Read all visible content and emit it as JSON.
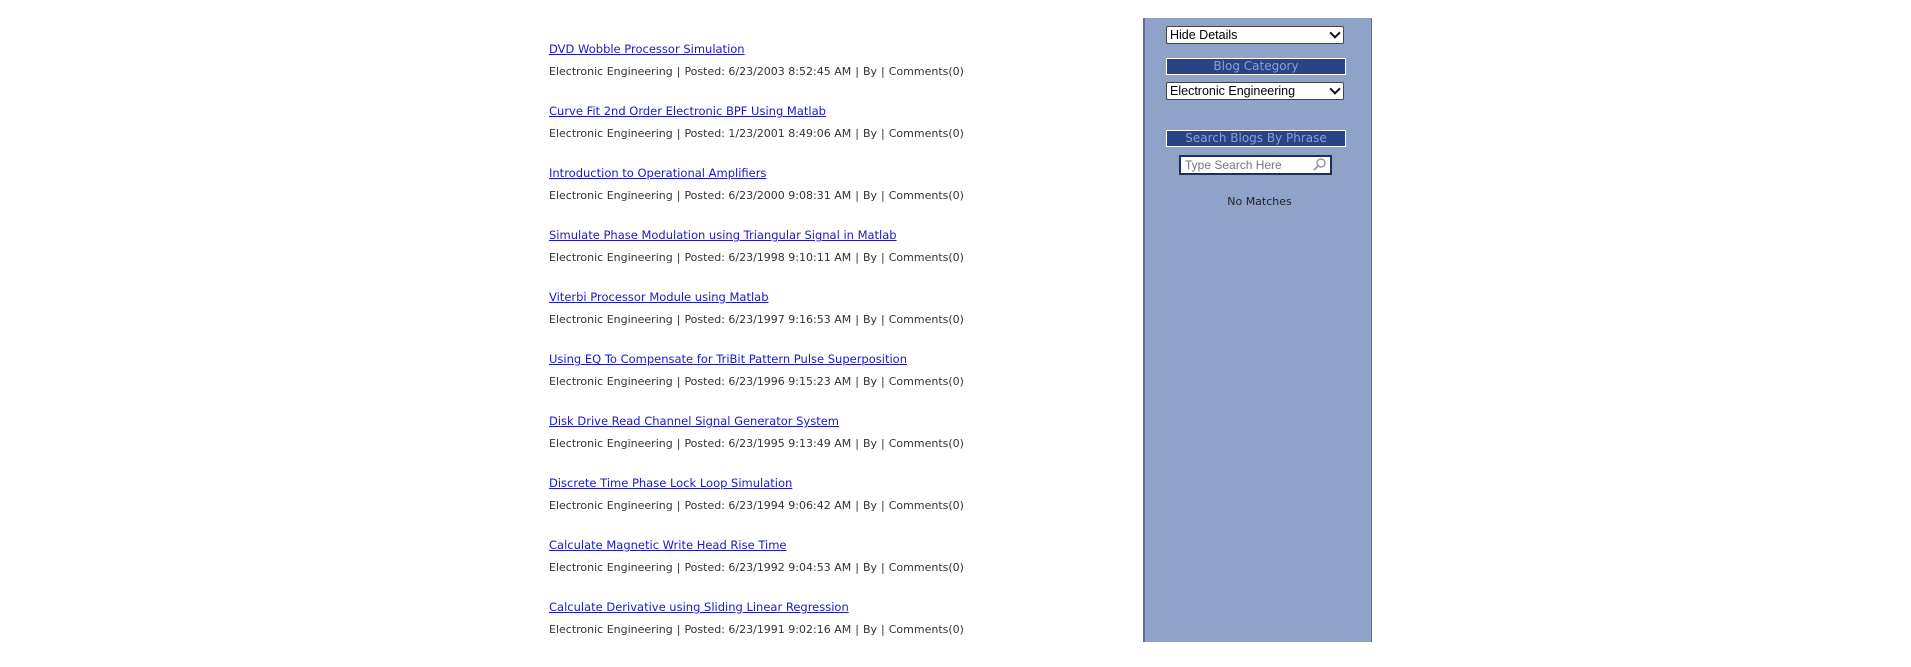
{
  "posts": [
    {
      "title": "DVD Wobble Processor Simulation",
      "category": "Electronic Engineering",
      "posted": "Posted: 6/23/2003 8:52:45 AM",
      "by": "By",
      "comments": "Comments(0)"
    },
    {
      "title": "Curve Fit 2nd Order Electronic BPF Using Matlab",
      "category": "Electronic Engineering",
      "posted": "Posted: 1/23/2001 8:49:06 AM",
      "by": "By",
      "comments": "Comments(0)"
    },
    {
      "title": "Introduction to Operational Amplifiers",
      "category": "Electronic Engineering",
      "posted": "Posted: 6/23/2000 9:08:31 AM",
      "by": "By",
      "comments": "Comments(0)"
    },
    {
      "title": "Simulate Phase Modulation using Triangular Signal in Matlab",
      "category": "Electronic Engineering",
      "posted": "Posted: 6/23/1998 9:10:11 AM",
      "by": "By",
      "comments": "Comments(0)"
    },
    {
      "title": "Viterbi Processor Module using Matlab",
      "category": "Electronic Engineering",
      "posted": "Posted: 6/23/1997 9:16:53 AM",
      "by": "By",
      "comments": "Comments(0)"
    },
    {
      "title": "Using EQ To Compensate for TriBit Pattern Pulse Superposition",
      "category": "Electronic Engineering",
      "posted": "Posted: 6/23/1996 9:15:23 AM",
      "by": "By",
      "comments": "Comments(0)"
    },
    {
      "title": "Disk Drive Read Channel Signal Generator System",
      "category": "Electronic Engineering",
      "posted": "Posted: 6/23/1995 9:13:49 AM",
      "by": "By",
      "comments": "Comments(0)"
    },
    {
      "title": "Discrete Time Phase Lock Loop Simulation",
      "category": "Electronic Engineering",
      "posted": "Posted: 6/23/1994 9:06:42 AM",
      "by": "By",
      "comments": "Comments(0)"
    },
    {
      "title": "Calculate Magnetic Write Head Rise Time",
      "category": "Electronic Engineering",
      "posted": "Posted: 6/23/1992 9:04:53 AM",
      "by": "By",
      "comments": "Comments(0)"
    },
    {
      "title": "Calculate Derivative using Sliding Linear Regression",
      "category": "Electronic Engineering",
      "posted": "Posted: 6/23/1991 9:02:16 AM",
      "by": "By",
      "comments": "Comments(0)"
    }
  ],
  "sidebar": {
    "details_select": "Hide Details",
    "category_header": "Blog Category",
    "category_select": "Electronic Engineering",
    "search_header": "Search Blogs By Phrase",
    "search_placeholder": "Type Search Here",
    "search_icon": "magnifier-icon",
    "no_matches": "No Matches",
    "colors": {
      "panel": "#8fa3c8",
      "header": "#2a4384",
      "link": "#1a1acc"
    }
  }
}
